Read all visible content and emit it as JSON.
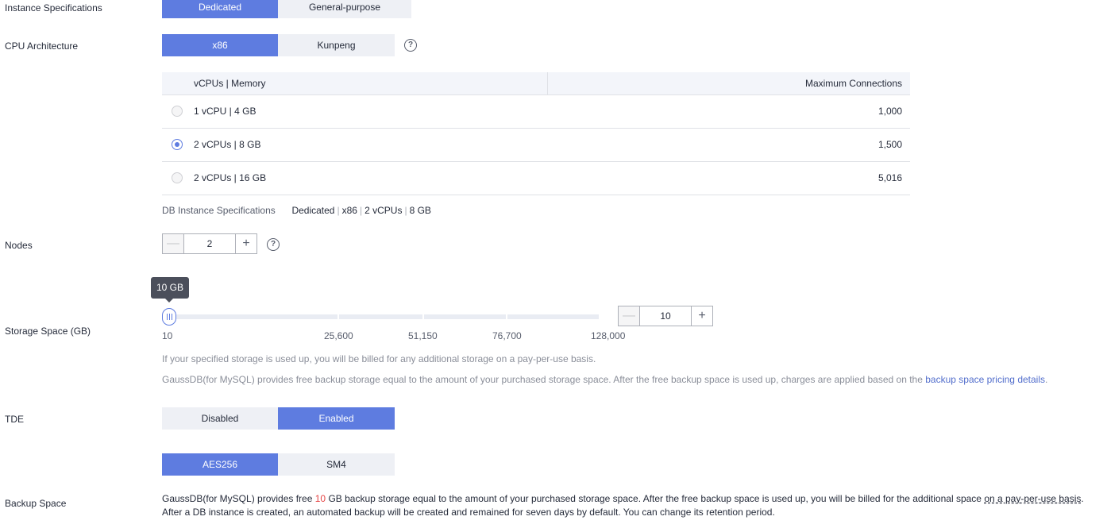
{
  "instance_specs": {
    "label": "Instance Specifications",
    "options": [
      "Dedicated",
      "General-purpose"
    ],
    "selected": "Dedicated"
  },
  "cpu_arch": {
    "label": "CPU Architecture",
    "options": [
      "x86",
      "Kunpeng"
    ],
    "selected": "x86",
    "help": "?"
  },
  "spec_table": {
    "headers": [
      "vCPUs | Memory",
      "Maximum Connections"
    ],
    "rows": [
      {
        "spec": "1 vCPU | 4 GB",
        "max": "1,000",
        "selected": false
      },
      {
        "spec": "2 vCPUs | 8 GB",
        "max": "1,500",
        "selected": true
      },
      {
        "spec": "2 vCPUs | 16 GB",
        "max": "5,016",
        "selected": false
      }
    ]
  },
  "summary": {
    "label": "DB Instance Specifications",
    "type": "Dedicated",
    "arch": "x86",
    "vcpus": "2 vCPUs",
    "memory": "8 GB"
  },
  "nodes": {
    "label": "Nodes",
    "minus": "—",
    "value": "2",
    "plus": "+",
    "help": "?"
  },
  "storage": {
    "label": "Storage Space (GB)",
    "tooltip": "10 GB",
    "ticks": [
      "10",
      "25,600",
      "51,150",
      "76,700",
      "128,000"
    ],
    "min": 10,
    "max": 128000,
    "current": 10,
    "minus": "—",
    "value": "10",
    "plus": "+",
    "note1": "If your specified storage is used up, you will be billed for any additional storage on a pay-per-use basis.",
    "note2": "GaussDB(for MySQL) provides free backup storage equal to the amount of your purchased storage space. After the free backup space is used up, charges are applied based on the",
    "note2_link": "backup space pricing details",
    "note2_end": "."
  },
  "tde": {
    "label": "TDE",
    "options": [
      "Disabled",
      "Enabled"
    ],
    "selected": "Enabled",
    "algorithms": [
      "AES256",
      "SM4"
    ],
    "algorithm_selected": "AES256"
  },
  "backup": {
    "label": "Backup Space",
    "line1_a": "GaussDB(for MySQL) provides free",
    "line1_num": "10",
    "line1_b": "GB backup storage equal to the amount of your purchased storage space. After the free backup space is used up, you will be billed for the additional space",
    "line1_link": "on a pay-per-use basis",
    "line1_end": ".",
    "line2": "After a DB instance is created, an automated backup will be created and remained for seven days by default. You can change its retention period."
  },
  "colors": {
    "accent": "#5e7ce0",
    "link": "#526ecc",
    "highlight": "#e54545"
  }
}
